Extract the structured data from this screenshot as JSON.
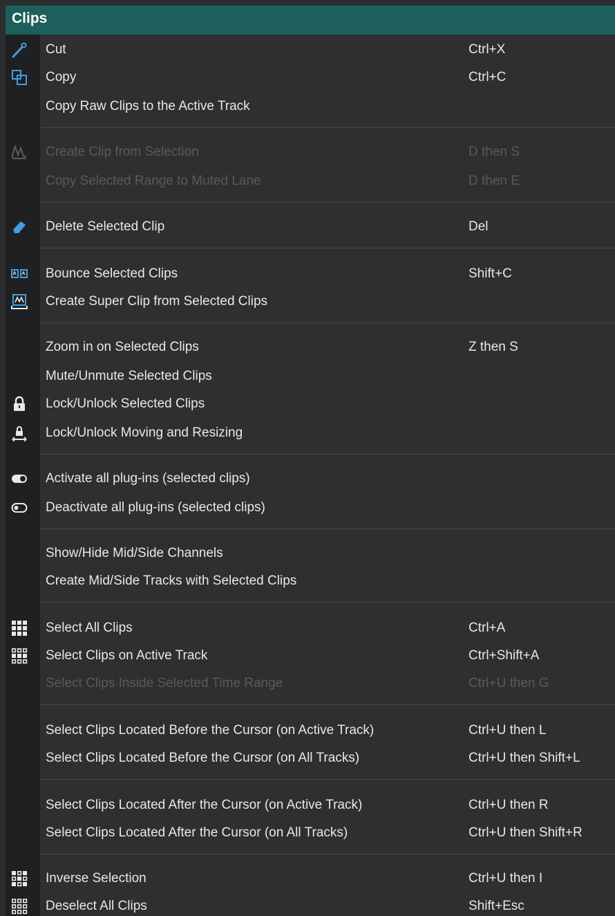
{
  "menu": {
    "title": "Clips",
    "items": [
      {
        "label": "Cut",
        "shortcut": "Ctrl+X",
        "icon": "cut-icon",
        "disabled": false
      },
      {
        "label": "Copy",
        "shortcut": "Ctrl+C",
        "icon": "copy-icon",
        "disabled": false
      },
      {
        "label": "Copy Raw Clips to the Active Track",
        "shortcut": "",
        "icon": "",
        "disabled": false
      },
      {
        "label": "Create Clip from Selection",
        "shortcut": "D then S",
        "icon": "create-clip-icon",
        "disabled": true
      },
      {
        "label": "Copy Selected Range to Muted Lane",
        "shortcut": "D then E",
        "icon": "",
        "disabled": true
      },
      {
        "label": "Delete Selected Clip",
        "shortcut": "Del",
        "icon": "eraser-icon",
        "disabled": false
      },
      {
        "label": "Bounce Selected Clips",
        "shortcut": "Shift+C",
        "icon": "bounce-icon",
        "disabled": false
      },
      {
        "label": "Create Super Clip from Selected Clips",
        "shortcut": "",
        "icon": "super-clip-icon",
        "disabled": false
      },
      {
        "label": "Zoom in on Selected Clips",
        "shortcut": "Z then S",
        "icon": "",
        "disabled": false
      },
      {
        "label": "Mute/Unmute Selected Clips",
        "shortcut": "",
        "icon": "",
        "disabled": false
      },
      {
        "label": "Lock/Unlock Selected Clips",
        "shortcut": "",
        "icon": "lock-icon",
        "disabled": false
      },
      {
        "label": "Lock/Unlock Moving and Resizing",
        "shortcut": "",
        "icon": "lock-move-icon",
        "disabled": false
      },
      {
        "label": "Activate all plug-ins (selected clips)",
        "shortcut": "",
        "icon": "toggle-on-icon",
        "disabled": false
      },
      {
        "label": "Deactivate all plug-ins (selected clips)",
        "shortcut": "",
        "icon": "toggle-off-icon",
        "disabled": false
      },
      {
        "label": "Show/Hide Mid/Side Channels",
        "shortcut": "",
        "icon": "",
        "disabled": false
      },
      {
        "label": "Create Mid/Side Tracks with Selected Clips",
        "shortcut": "",
        "icon": "",
        "disabled": false
      },
      {
        "label": "Select All Clips",
        "shortcut": "Ctrl+A",
        "icon": "grid-filled-icon",
        "disabled": false
      },
      {
        "label": "Select Clips on Active Track",
        "shortcut": "Ctrl+Shift+A",
        "icon": "grid-track-icon",
        "disabled": false
      },
      {
        "label": "Select Clips Inside Selected Time Range",
        "shortcut": "Ctrl+U then G",
        "icon": "",
        "disabled": true
      },
      {
        "label": "Select Clips Located Before the Cursor (on Active Track)",
        "shortcut": "Ctrl+U then L",
        "icon": "",
        "disabled": false
      },
      {
        "label": "Select Clips Located Before the Cursor (on All Tracks)",
        "shortcut": "Ctrl+U then Shift+L",
        "icon": "",
        "disabled": false
      },
      {
        "label": "Select Clips Located After the Cursor (on Active Track)",
        "shortcut": "Ctrl+U then R",
        "icon": "",
        "disabled": false
      },
      {
        "label": "Select Clips Located After the Cursor (on All Tracks)",
        "shortcut": "Ctrl+U then Shift+R",
        "icon": "",
        "disabled": false
      },
      {
        "label": "Inverse Selection",
        "shortcut": "Ctrl+U then I",
        "icon": "grid-inverse-icon",
        "disabled": false
      },
      {
        "label": "Deselect All Clips",
        "shortcut": "Shift+Esc",
        "icon": "grid-outline-icon",
        "disabled": false
      }
    ]
  },
  "colors": {
    "header_bg": "#1d5f5b",
    "menu_bg": "#2e2f31",
    "gutter_bg": "#1f2022",
    "text": "#e8e8e8",
    "disabled_text": "#595a5c",
    "icon_accent": "#3f9fe0"
  }
}
